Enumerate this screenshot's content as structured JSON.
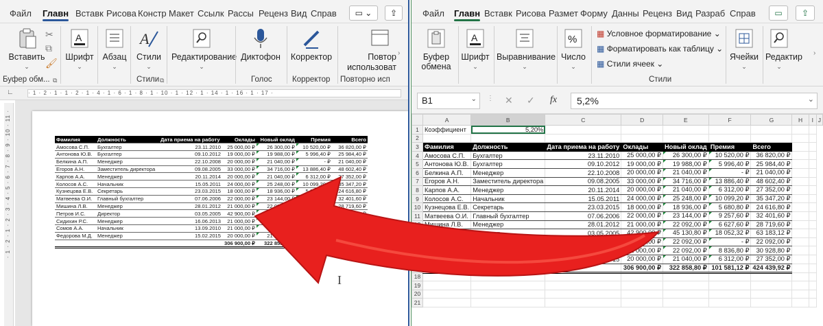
{
  "word": {
    "tabs": [
      "Файл",
      "Главн",
      "Вставк",
      "Рисова",
      "Констр",
      "Макет",
      "Ссылк",
      "Рассы",
      "Реценз",
      "Вид",
      "Справ"
    ],
    "ribbon": {
      "paste": "Вставить",
      "font": "Шрифт",
      "paragraph": "Абзац",
      "styles": "Стили",
      "editing": "Редактирование",
      "dictate": "Диктофон",
      "editor": "Корректор",
      "reuse_line1": "Повтор",
      "reuse_line2": "использоват"
    },
    "groups": {
      "clipboard": "Буфер обм...",
      "styles": "Стили",
      "voice": "Голос",
      "editor": "Корректор",
      "reuse": "Повторно исп"
    },
    "ruler": "· 1 · 2 · 1 · 1 · 2 · 1 · 4 · 1 · 6 · 1 · 8 · 1 · 10 · 1 · 12 · 1 · 14 · 1 · 16 · 1 · 17 ·",
    "vruler": "· 1 · 2 · 1 · 2 · 3 · 4 · 5 · 6 · 7 · 8 · 9 · 10 · 11 ·",
    "table": {
      "headers": [
        "Фамилия",
        "Должность",
        "Дата приема на работу",
        "Оклады",
        "Новый оклад",
        "Премия",
        "Всего"
      ],
      "rows": [
        [
          "Амосова С.П.",
          "Бухгалтер",
          "23.11.2010",
          "25 000,00 ₽",
          "26 300,00 ₽",
          "10 520,00 ₽",
          "36 820,00 ₽"
        ],
        [
          "Антонова Ю.В.",
          "Бухгалтер",
          "09.10.2012",
          "19 000,00 ₽",
          "19 988,00 ₽",
          "5 996,40 ₽",
          "25 984,40 ₽"
        ],
        [
          "Белкина А.П.",
          "Менеджер",
          "22.10.2008",
          "20 000,00 ₽",
          "21 040,00 ₽",
          "-   ₽",
          "21 040,00 ₽"
        ],
        [
          "Егоров А.Н.",
          "Заместитель директора",
          "09.08.2005",
          "33 000,00 ₽",
          "34 716,00 ₽",
          "13 886,40 ₽",
          "48 602,40 ₽"
        ],
        [
          "Карпов А.А.",
          "Менеджер",
          "20.11.2014",
          "20 000,00 ₽",
          "21 040,00 ₽",
          "6 312,00 ₽",
          "27 352,00 ₽"
        ],
        [
          "Колосов А.С.",
          "Начальник",
          "15.05.2011",
          "24 000,00 ₽",
          "25 248,00 ₽",
          "10 099,20 ₽",
          "35 347,20 ₽"
        ],
        [
          "Кузнецова Е.В.",
          "Секретарь",
          "23.03.2015",
          "18 000,00 ₽",
          "18 936,00 ₽",
          "5 680,80 ₽",
          "24 616,80 ₽"
        ],
        [
          "Матвеева О.И.",
          "Главный бухгалтер",
          "07.06.2006",
          "22 000,00 ₽",
          "23 144,00 ₽",
          "9 257,60 ₽",
          "32 401,60 ₽"
        ],
        [
          "Мишина Л.В.",
          "Менеджер",
          "28.01.2012",
          "21 000,00 ₽",
          "22 092,00 ₽",
          "6 627,60 ₽",
          "28 719,60 ₽"
        ],
        [
          "Петров И.С.",
          "Директор",
          "03.05.2005",
          "42 900,00 ₽",
          "45 130,80 ₽",
          "18 052,32 ₽",
          "63 183,12 ₽"
        ],
        [
          "Сидихин Р.С.",
          "Менеджер",
          "16.06.2013",
          "21 000,00 ₽",
          "22 092,00 ₽",
          "-   ₽",
          "22 092,00 ₽"
        ],
        [
          "Сомов А.А.",
          "Начальник",
          "13.09.2010",
          "21 000,00 ₽",
          "22 092,00 ₽",
          "8 836,80 ₽",
          "30 928,80 ₽"
        ],
        [
          "Федорова М.Д.",
          "Менеджер",
          "15.02.2015",
          "20 000,00 ₽",
          "21 040,00 ₽",
          "6 312,00 ₽",
          "27 352,00 ₽"
        ]
      ],
      "totals": [
        "",
        "",
        "",
        "306 900,00 ₽",
        "322 858,80 ₽",
        "101 581,12 ₽",
        "424 439,92 ₽"
      ]
    }
  },
  "excel": {
    "tabs": [
      "Файл",
      "Главн",
      "Вставк",
      "Рисова",
      "Размет",
      "Форму",
      "Данны",
      "Реценз",
      "Вид",
      "Разраб",
      "Справ"
    ],
    "ribbon": {
      "clipboard_line1": "Буфер",
      "clipboard_line2": "обмена",
      "font": "Шрифт",
      "alignment": "Выравнивание",
      "number": "Число",
      "cond_format": "Условное форматирование",
      "format_table": "Форматировать как таблицу",
      "cell_styles": "Стили ячеек",
      "cells": "Ячейки",
      "editing": "Редактир"
    },
    "groups": {
      "styles": "Стили"
    },
    "namebox": "B1",
    "fx": "fx",
    "formula_value": "5,2%",
    "columns": [
      "",
      "A",
      "B",
      "C",
      "D",
      "E",
      "F",
      "G",
      "H",
      "I",
      "J"
    ],
    "coef_label": "Коэффициент",
    "coef_value": "5,20%",
    "empty_rows": [
      "18",
      "19",
      "20",
      "21"
    ]
  },
  "colors": {
    "word_accent": "#2b579a",
    "excel_accent": "#217346",
    "arrow": "#e8201e"
  }
}
